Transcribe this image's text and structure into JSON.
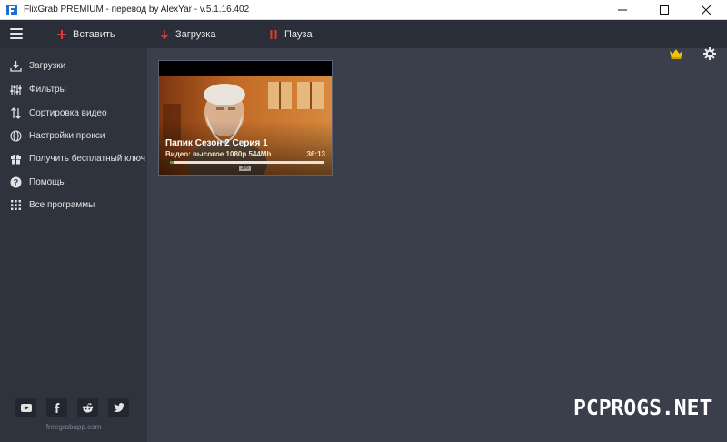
{
  "window": {
    "title": "FlixGrab PREMIUM - перевод by AlexYar - v.5.1.16.402"
  },
  "toolbar": {
    "insert_label": "Вставить",
    "download_label": "Загрузка",
    "pause_label": "Пауза",
    "icons": {
      "insert": "plus-icon",
      "download": "arrow-down-icon",
      "pause": "pause-icon",
      "premium": "crown-icon",
      "settings": "gear-icon"
    }
  },
  "sidebar": {
    "items": [
      {
        "label": "Загрузки",
        "icon": "download-icon"
      },
      {
        "label": "Фильтры",
        "icon": "filter-sliders-icon"
      },
      {
        "label": "Сортировка видео",
        "icon": "sort-icon"
      },
      {
        "label": "Настройки прокси",
        "icon": "globe-icon"
      },
      {
        "label": "Получить бесплатный ключ",
        "icon": "gift-icon"
      },
      {
        "label": "Помощь",
        "icon": "help-icon"
      },
      {
        "label": "Все программы",
        "icon": "grid-dots-icon"
      }
    ],
    "socials": [
      "youtube-icon",
      "facebook-icon",
      "reddit-icon",
      "twitter-icon"
    ],
    "site": "freegrabapp.com"
  },
  "downloads": [
    {
      "title": "Папик Сезон 2 Серия 1",
      "meta": "Видео: высокое 1080p 544Mb",
      "duration": "36:13",
      "progress": 0.03,
      "progress_label": "3%"
    }
  ],
  "watermark": "PCPROGS.NET",
  "colors": {
    "accent_red": "#e53935",
    "crown_gold": "#f4c20d",
    "progress_green": "#3aa655",
    "sidebar_bg": "#2f333e",
    "content_bg": "#3a3f4b",
    "toolbar_bg": "#2a2e38"
  }
}
